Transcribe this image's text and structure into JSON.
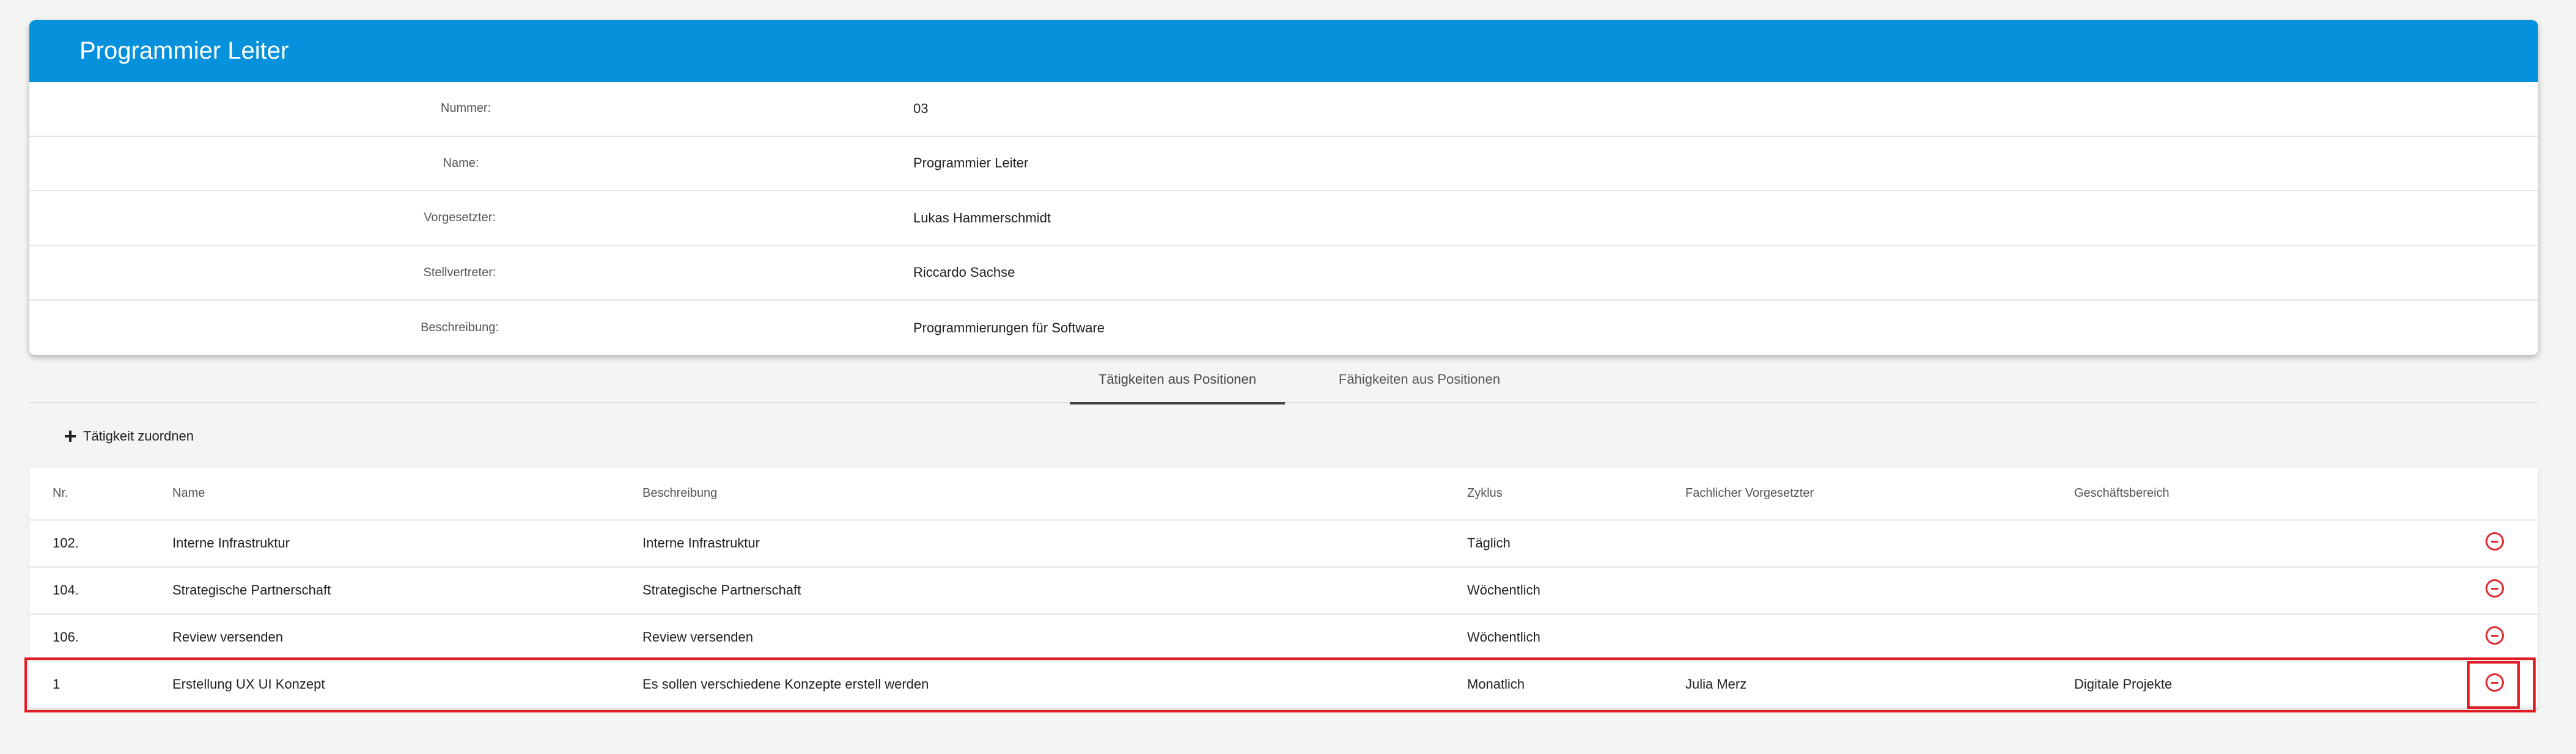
{
  "header": {
    "title": "Programmier Leiter"
  },
  "details": [
    {
      "label": "Nummer:",
      "value": "03"
    },
    {
      "label": "Name:",
      "value": "Programmier Leiter"
    },
    {
      "label": "Vorgesetzter:",
      "value": "Lukas Hammerschmidt"
    },
    {
      "label": "Stellvertreter:",
      "value": "Riccardo Sachse"
    },
    {
      "label": "Beschreibung:",
      "value": "Programmierungen für Software"
    }
  ],
  "tabs": [
    {
      "label": "Tätigkeiten aus Positionen",
      "active": true
    },
    {
      "label": "Fähigkeiten aus Positionen",
      "active": false
    }
  ],
  "actions": {
    "add_label": "Tätigkeit zuordnen"
  },
  "table": {
    "columns": [
      "Nr.",
      "Name",
      "Beschreibung",
      "Zyklus",
      "Fachlicher Vorgesetzter",
      "Geschäftsbereich"
    ],
    "rows": [
      {
        "nr": "102.",
        "name": "Interne Infrastruktur",
        "beschreibung": "Interne Infrastruktur",
        "zyklus": "Täglich",
        "vorgesetzter": "",
        "bereich": ""
      },
      {
        "nr": "104.",
        "name": "Strategische Partnerschaft",
        "beschreibung": "Strategische Partnerschaft",
        "zyklus": "Wöchentlich",
        "vorgesetzter": "",
        "bereich": ""
      },
      {
        "nr": "106.",
        "name": "Review versenden",
        "beschreibung": "Review versenden",
        "zyklus": "Wöchentlich",
        "vorgesetzter": "",
        "bereich": ""
      },
      {
        "nr": "1",
        "name": "Erstellung UX UI Konzept",
        "beschreibung": "Es sollen verschiedene Konzepte erstell werden",
        "zyklus": "Monatlich",
        "vorgesetzter": "Julia Merz",
        "bereich": "Digitale Projekte"
      }
    ]
  },
  "icons": {
    "remove": "minus-circle-icon",
    "add": "plus-icon"
  },
  "colors": {
    "header_bg": "#0591db",
    "remove_icon": "#e0282e",
    "highlight": "#e01b24"
  }
}
